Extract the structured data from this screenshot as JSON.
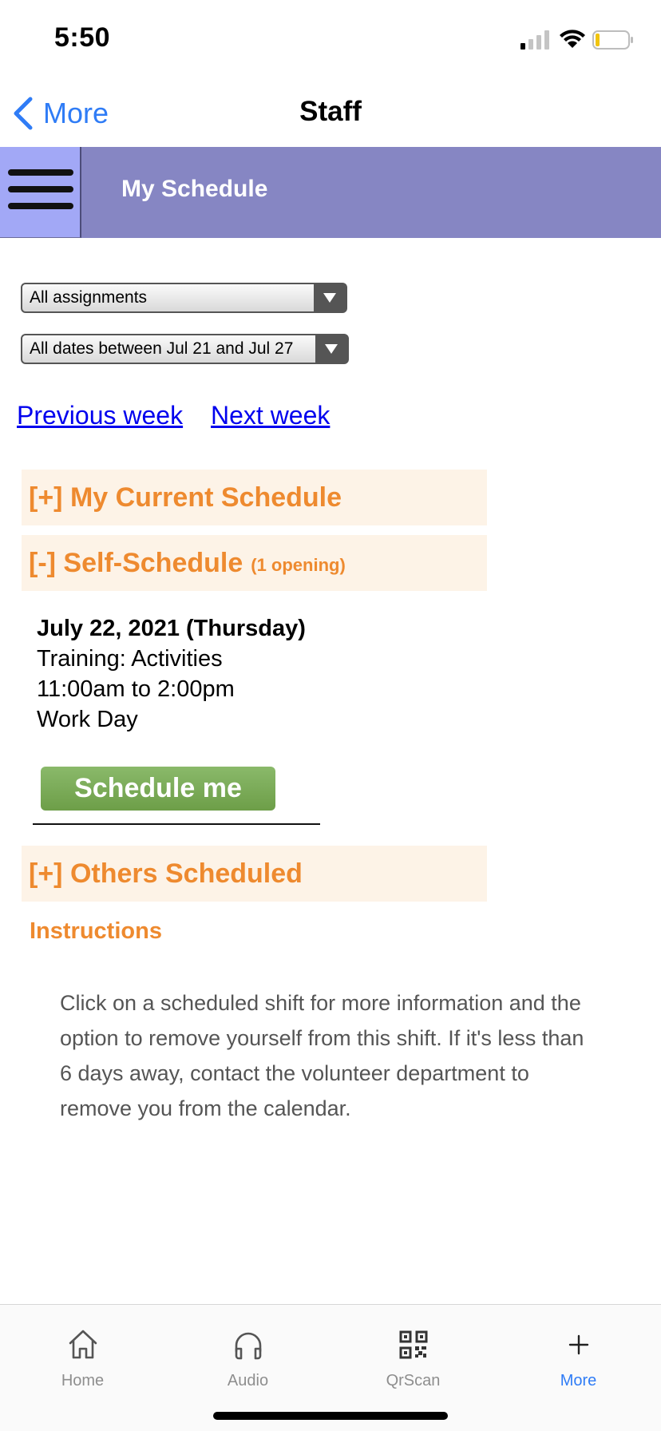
{
  "status_bar": {
    "time": "5:50"
  },
  "nav": {
    "back_label": "More",
    "title": "Staff"
  },
  "header": {
    "title": "My Schedule"
  },
  "filters": {
    "assignment_select": "All assignments",
    "date_select": "All dates between Jul 21 and Jul 27"
  },
  "week_links": {
    "previous": "Previous week",
    "next": "Next week"
  },
  "sections": {
    "current": "[+] My Current Schedule",
    "self_schedule": "[-] Self-Schedule",
    "self_schedule_count": "(1 opening)",
    "others": "[+] Others Scheduled"
  },
  "shift": {
    "date": "July 22, 2021 (Thursday)",
    "name": "Training: Activities",
    "time": "11:00am to 2:00pm",
    "type": "Work Day",
    "button": "Schedule me"
  },
  "instructions": {
    "title": "Instructions",
    "body": "Click on a scheduled shift for more information and the option to remove yourself from this shift. If it's less than 6 days away, contact the volunteer department to remove you from the calendar."
  },
  "tabs": [
    {
      "label": "Home",
      "icon": "home-icon"
    },
    {
      "label": "Audio",
      "icon": "headphones-icon"
    },
    {
      "label": "QrScan",
      "icon": "qr-code-icon"
    },
    {
      "label": "More",
      "icon": "plus-icon"
    }
  ],
  "colors": {
    "accent": "#2f7cf6",
    "header_bg": "#8686c3",
    "menu_bg": "#a2a8f6",
    "section_text": "#ee8a2f",
    "section_bg": "#fdf3e7",
    "button_green": "#7aab56"
  }
}
